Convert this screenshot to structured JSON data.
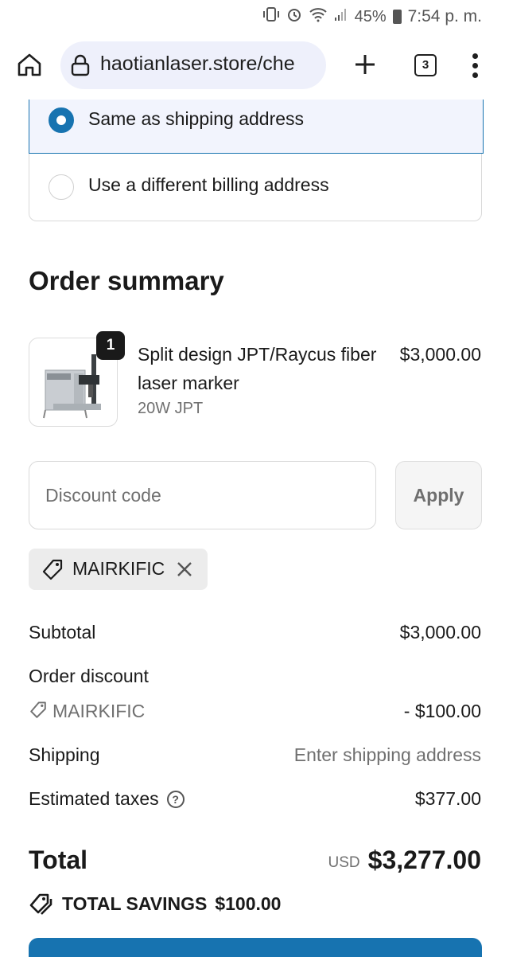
{
  "status_bar": {
    "battery": "45%",
    "time": "7:54 p. m."
  },
  "browser": {
    "url": "haotianlaser.store/che",
    "tab_count": "3",
    "icons": [
      "home-icon",
      "lock-icon",
      "plus-icon",
      "tabs-icon",
      "menu-icon"
    ]
  },
  "billing": {
    "options": [
      {
        "label": "Same as shipping address",
        "selected": true
      },
      {
        "label": "Use a different billing address",
        "selected": false
      }
    ]
  },
  "order_summary": {
    "title": "Order summary",
    "product": {
      "quantity": "1",
      "name": "Split design JPT/Raycus fiber laser marker",
      "variant": "20W JPT",
      "price": "$3,000.00"
    },
    "discount": {
      "placeholder": "Discount code",
      "apply_label": "Apply",
      "applied_code": "MAIRKIFIC"
    },
    "lines": {
      "subtotal_label": "Subtotal",
      "subtotal_value": "$3,000.00",
      "order_discount_label": "Order discount",
      "order_discount_code": "MAIRKIFIC",
      "order_discount_value": "- $100.00",
      "shipping_label": "Shipping",
      "shipping_value": "Enter shipping address",
      "taxes_label": "Estimated taxes",
      "taxes_help": "?",
      "taxes_value": "$377.00"
    },
    "total": {
      "label": "Total",
      "currency": "USD",
      "amount": "$3,277.00"
    },
    "savings": {
      "label": "TOTAL SAVINGS",
      "amount": "$100.00"
    }
  },
  "colors": {
    "accent": "#1773b0",
    "selected_bg": "#f2f4fd",
    "muted_text": "#707070"
  }
}
